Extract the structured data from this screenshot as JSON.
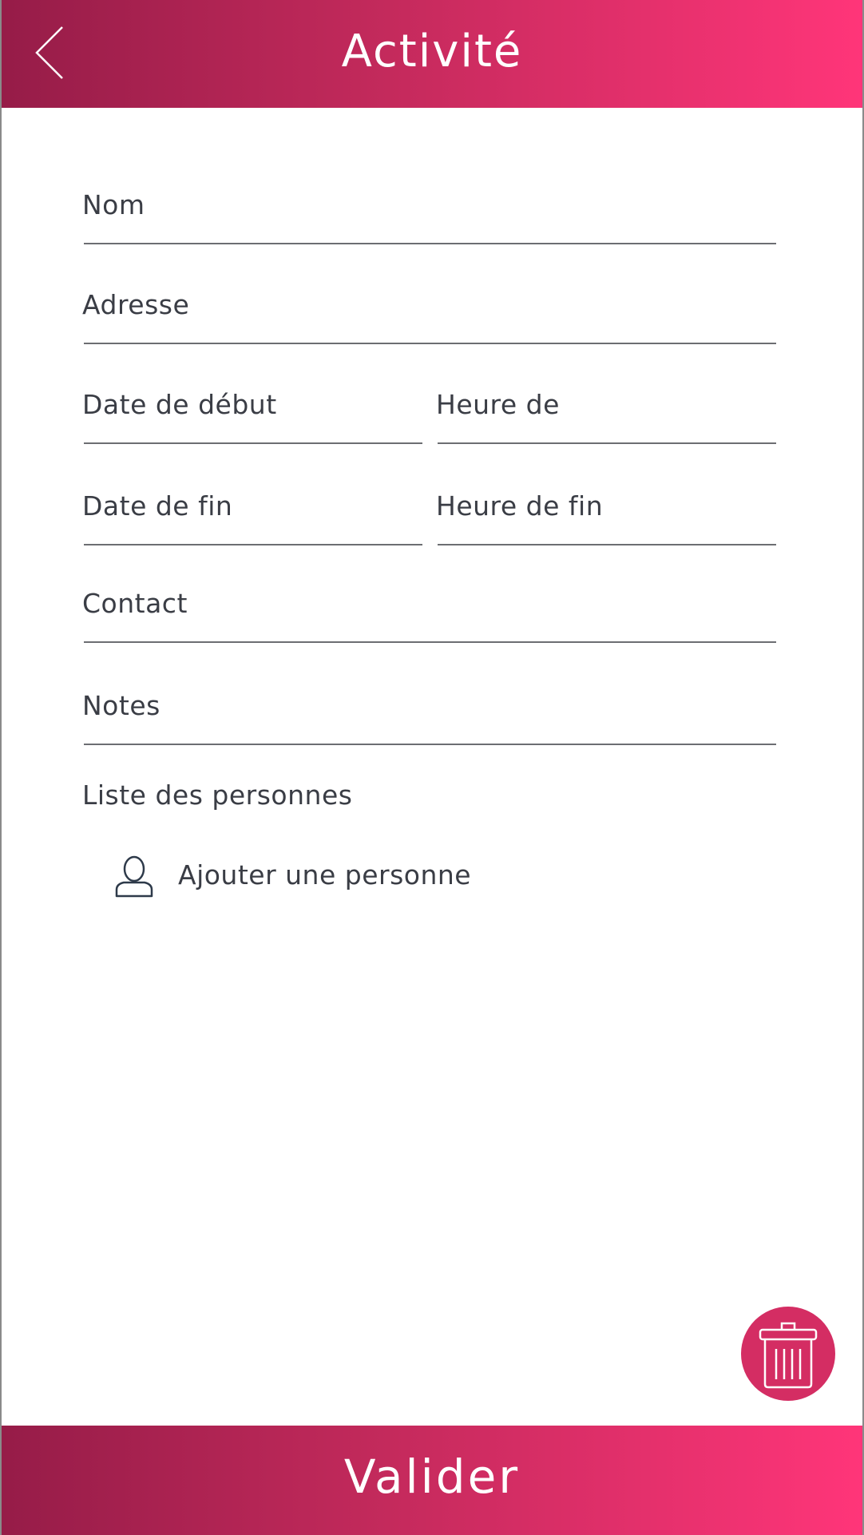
{
  "header": {
    "title": "Activité",
    "back_icon": "chevron-left-icon"
  },
  "form": {
    "name_label": "Nom",
    "address_label": "Adresse",
    "start_date_label": "Date de début",
    "start_time_label": "Heure de",
    "end_date_label": "Date de fin",
    "end_time_label": "Heure de fin",
    "contact_label": "Contact",
    "notes_label": "Notes"
  },
  "people": {
    "section_title": "Liste des personnes",
    "add_label": "Ajouter une personne",
    "add_icon": "person-icon"
  },
  "actions": {
    "delete_icon": "trash-icon",
    "submit_label": "Valider"
  },
  "colors": {
    "gradient_start": "#961c48",
    "gradient_end": "#ff3579",
    "accent": "#d42d63",
    "text": "#3a3d45"
  }
}
